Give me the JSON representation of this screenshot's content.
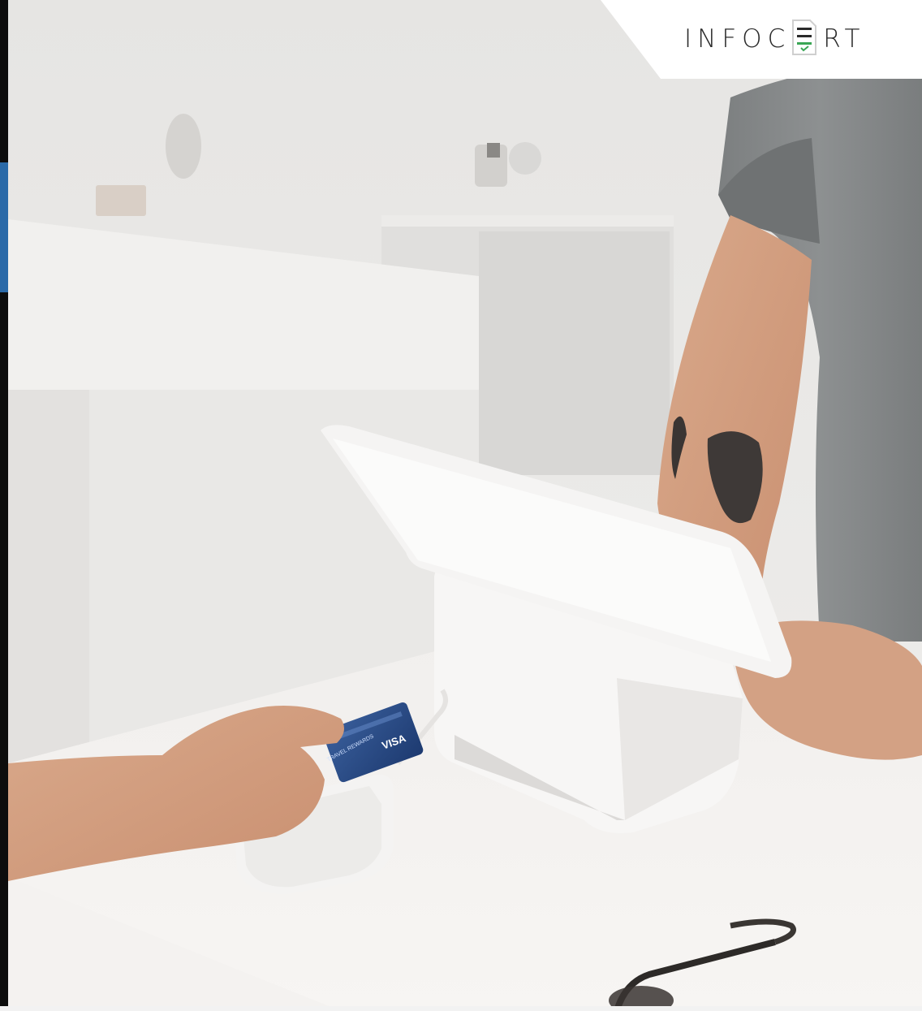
{
  "brand": {
    "logo_text_left": "INFOC",
    "logo_text_right": "RT",
    "logo_glyph": "E-document-check-icon",
    "logo_color": "#2a2a2a",
    "logo_accent": "#3aa655"
  },
  "photo": {
    "card_network": "VISA",
    "card_text": "TRAVEL REWARDS"
  }
}
